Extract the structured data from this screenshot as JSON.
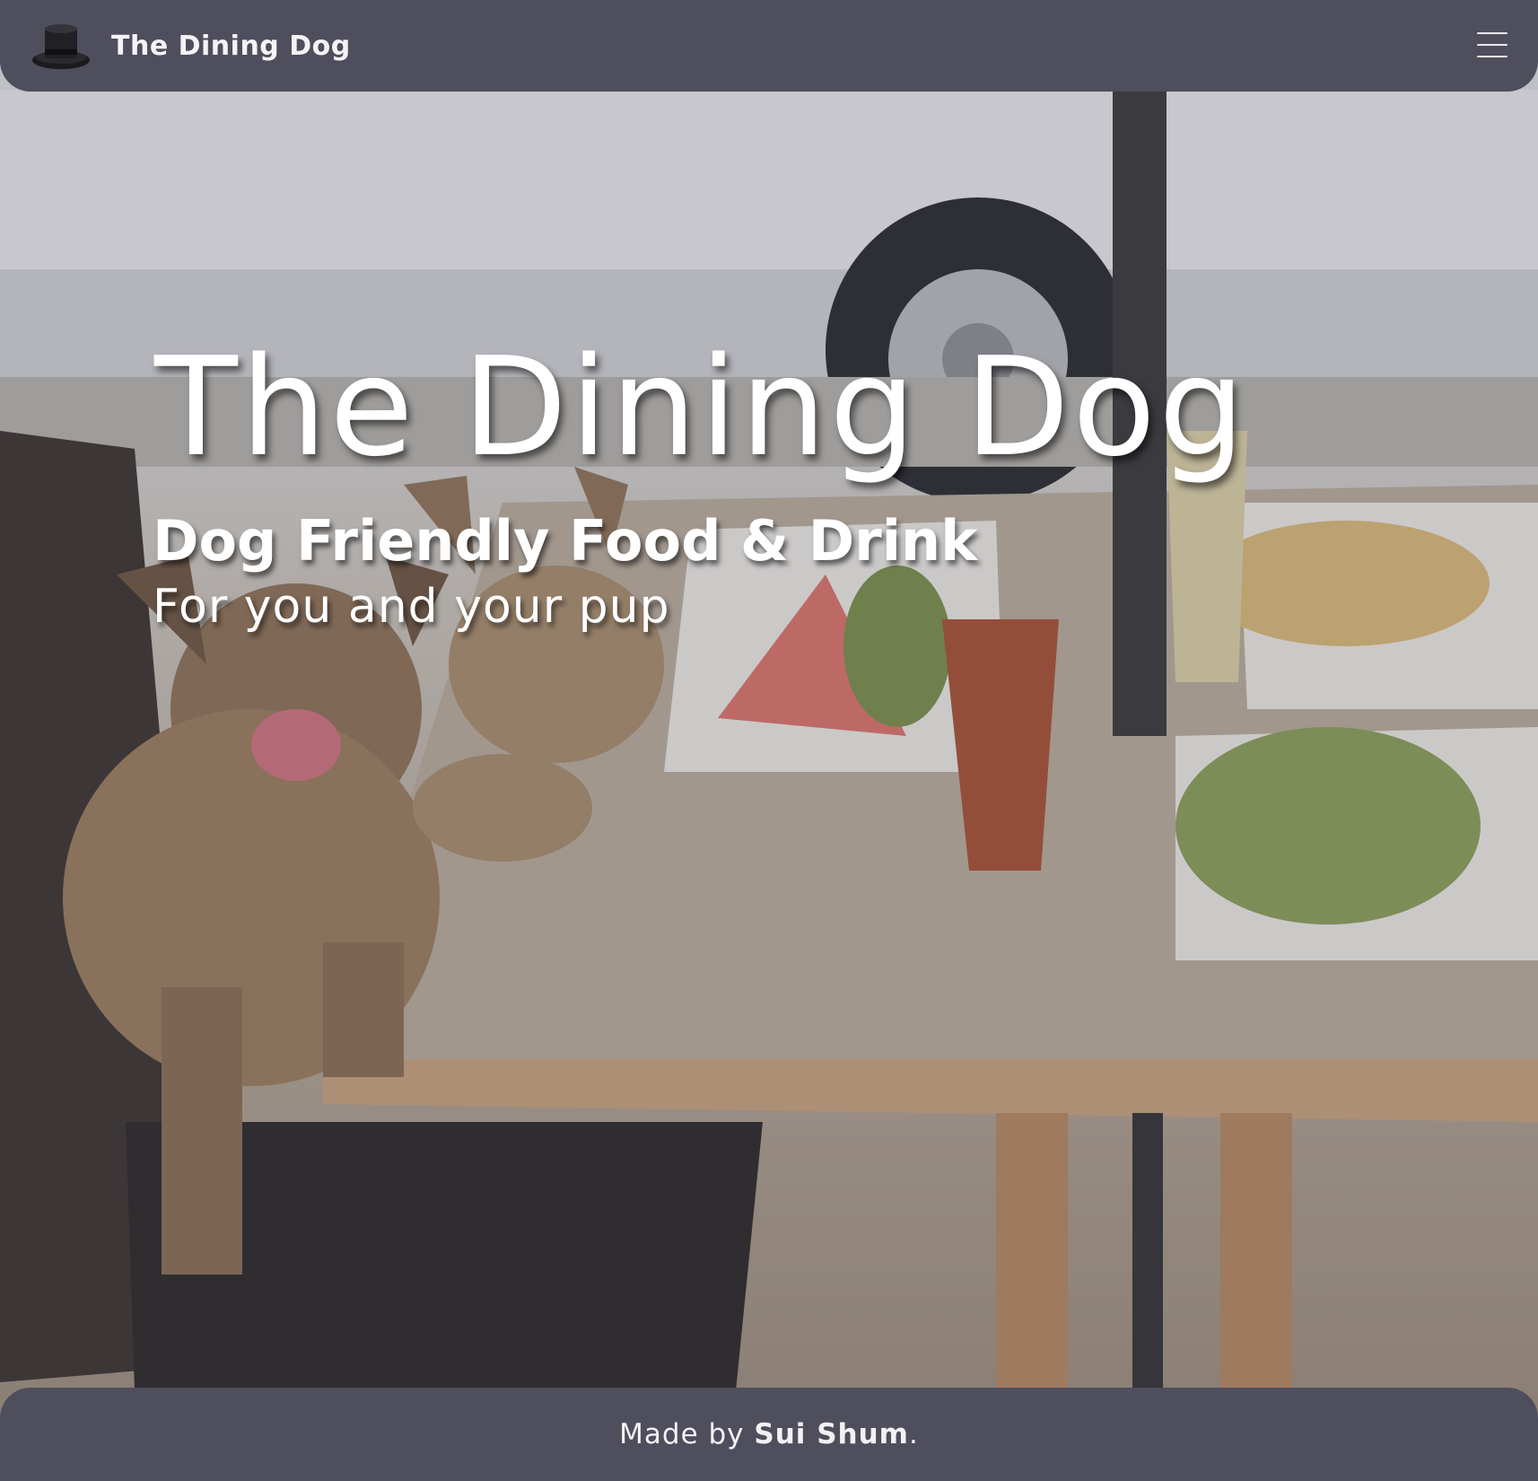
{
  "navbar": {
    "brand_name": "The Dining Dog",
    "brand_icon": "top-hat-icon",
    "menu_icon": "hamburger-menu-icon"
  },
  "hero": {
    "title": "The Dining Dog",
    "subtitle": "Dog Friendly Food & Drink",
    "tagline": "For you and your pup"
  },
  "footer": {
    "prefix": "Made by ",
    "author": "Sui Shum",
    "suffix": "."
  },
  "colors": {
    "bar_background": "#4f4e5c",
    "text_light": "#ffffff"
  }
}
